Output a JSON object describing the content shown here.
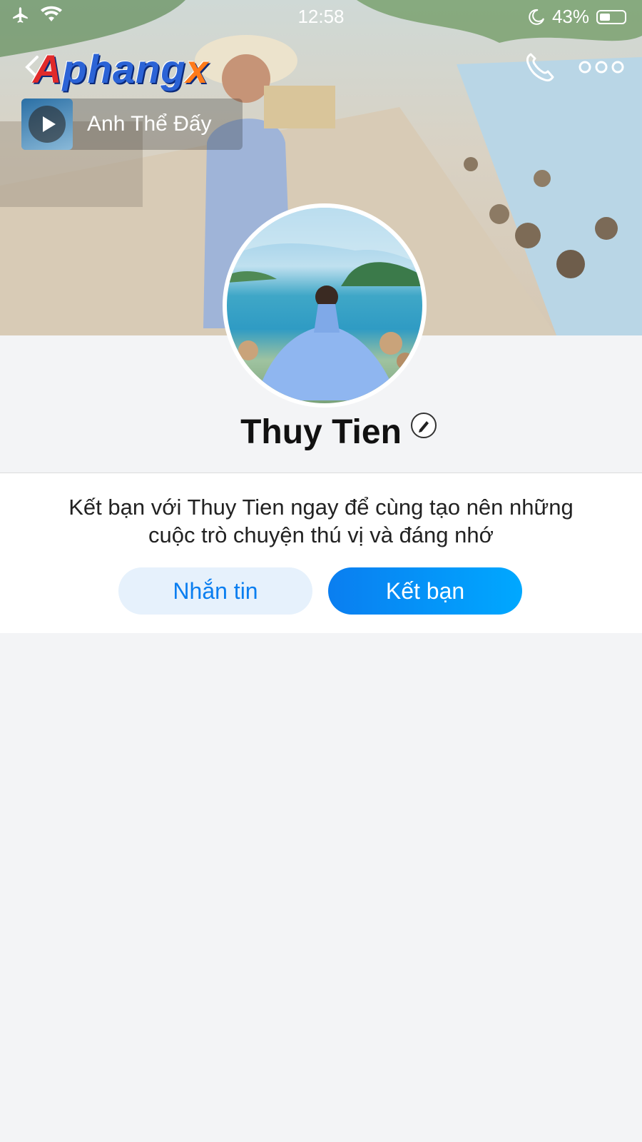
{
  "status_bar": {
    "time": "12:58",
    "battery": "43%"
  },
  "header": {
    "logo_part1": "A",
    "logo_part2": "phang",
    "logo_part3": "x"
  },
  "music": {
    "title": "Anh Thể Đấy"
  },
  "profile": {
    "name": "Thuy Tien"
  },
  "card": {
    "invite_text": "Kết bạn với Thuy Tien ngay để cùng tạo nên những cuộc trò chuyện thú vị và đáng nhớ",
    "message_label": "Nhắn tin",
    "add_friend_label": "Kết bạn"
  },
  "colors": {
    "accent": "#0a7ef0",
    "background": "#f3f4f6"
  }
}
